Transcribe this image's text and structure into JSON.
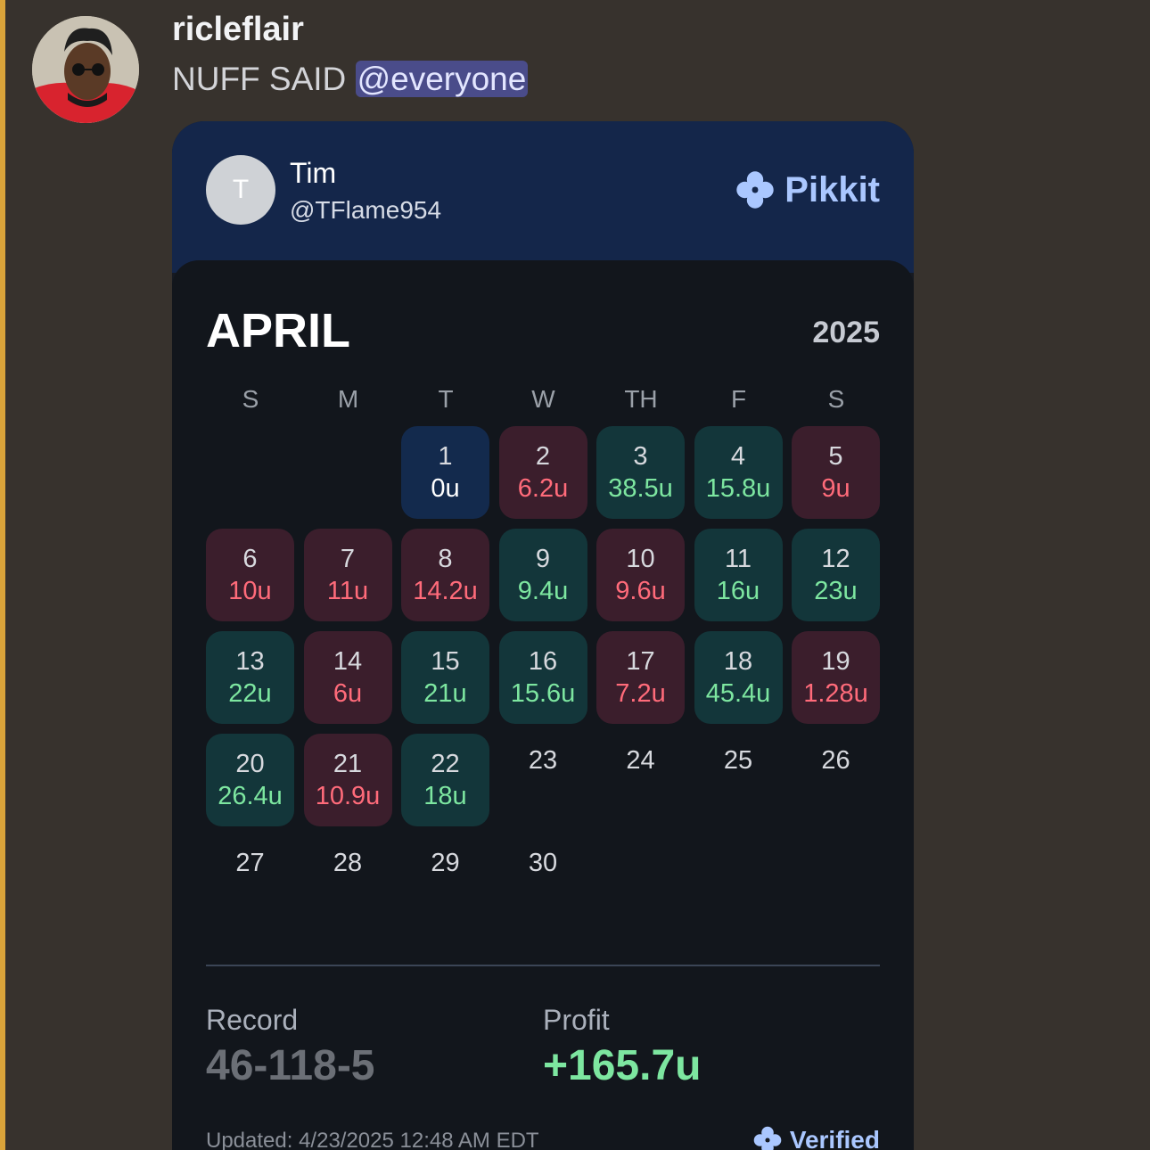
{
  "message": {
    "username": "ricleflair",
    "text": "NUFF SAID",
    "mention": "@everyone"
  },
  "card": {
    "avatar_initial": "T",
    "name": "Tim",
    "handle": "@TFlame954",
    "brand": "Pikkit",
    "brand_icon": "clover-icon",
    "month": "APRIL",
    "year": "2025",
    "weekdays": [
      "S",
      "M",
      "T",
      "W",
      "TH",
      "F",
      "S"
    ],
    "first_weekday_index": 2,
    "days": [
      {
        "day": "1",
        "amount": "0u",
        "result": "push"
      },
      {
        "day": "2",
        "amount": "6.2u",
        "result": "loss"
      },
      {
        "day": "3",
        "amount": "38.5u",
        "result": "win"
      },
      {
        "day": "4",
        "amount": "15.8u",
        "result": "win"
      },
      {
        "day": "5",
        "amount": "9u",
        "result": "loss"
      },
      {
        "day": "6",
        "amount": "10u",
        "result": "loss"
      },
      {
        "day": "7",
        "amount": "11u",
        "result": "loss"
      },
      {
        "day": "8",
        "amount": "14.2u",
        "result": "loss"
      },
      {
        "day": "9",
        "amount": "9.4u",
        "result": "win"
      },
      {
        "day": "10",
        "amount": "9.6u",
        "result": "loss"
      },
      {
        "day": "11",
        "amount": "16u",
        "result": "win"
      },
      {
        "day": "12",
        "amount": "23u",
        "result": "win"
      },
      {
        "day": "13",
        "amount": "22u",
        "result": "win"
      },
      {
        "day": "14",
        "amount": "6u",
        "result": "loss"
      },
      {
        "day": "15",
        "amount": "21u",
        "result": "win"
      },
      {
        "day": "16",
        "amount": "15.6u",
        "result": "win"
      },
      {
        "day": "17",
        "amount": "7.2u",
        "result": "loss"
      },
      {
        "day": "18",
        "amount": "45.4u",
        "result": "win"
      },
      {
        "day": "19",
        "amount": "1.28u",
        "result": "loss"
      },
      {
        "day": "20",
        "amount": "26.4u",
        "result": "win"
      },
      {
        "day": "21",
        "amount": "10.9u",
        "result": "loss"
      },
      {
        "day": "22",
        "amount": "18u",
        "result": "win"
      },
      {
        "day": "23",
        "amount": "",
        "result": "empty"
      },
      {
        "day": "24",
        "amount": "",
        "result": "empty"
      },
      {
        "day": "25",
        "amount": "",
        "result": "empty"
      },
      {
        "day": "26",
        "amount": "",
        "result": "empty"
      },
      {
        "day": "27",
        "amount": "",
        "result": "empty"
      },
      {
        "day": "28",
        "amount": "",
        "result": "empty"
      },
      {
        "day": "29",
        "amount": "",
        "result": "empty"
      },
      {
        "day": "30",
        "amount": "",
        "result": "empty"
      }
    ],
    "record_label": "Record",
    "record_value": "46-118-5",
    "profit_label": "Profit",
    "profit_value": "+165.7u",
    "updated": "Updated: 4/23/2025 12:48 AM EDT",
    "verified": "Verified"
  },
  "colors": {
    "win": "#7de6a0",
    "loss": "#ff6b7a",
    "brand": "#aac7ff",
    "mention_bar": "#d9a33a"
  }
}
